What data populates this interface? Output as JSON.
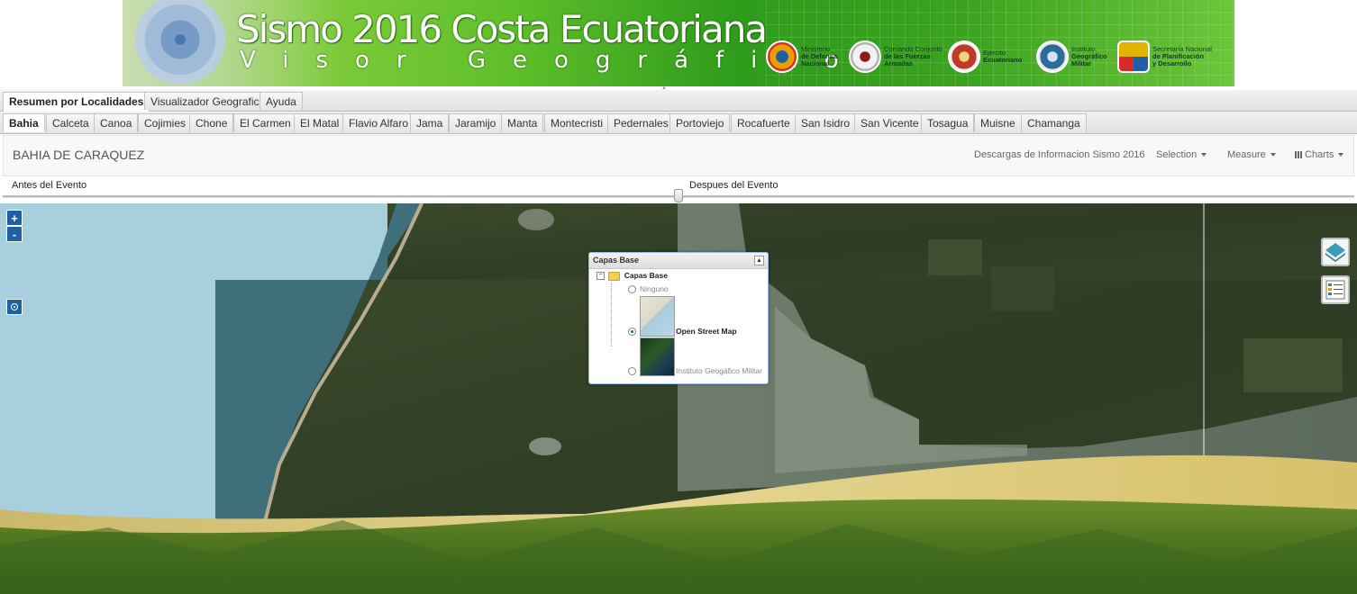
{
  "banner": {
    "title": "Sismo 2016 Costa Ecuatoriana",
    "subtitle": "Visor Geográfico",
    "logos": [
      {
        "line1": "Ministerio",
        "line2": "de Defensa",
        "line3": "Nacional",
        "color": "#e8a000"
      },
      {
        "line1": "Comando Conjunto",
        "line2": "de las Fuerzas",
        "line3": "Armadas",
        "color": "#c8c8c8"
      },
      {
        "line1": "Ejército",
        "line2": "Ecuatoriano",
        "line3": "",
        "color": "#c0392b"
      },
      {
        "line1": "Instituto",
        "line2": "Geográfico",
        "line3": "Militar",
        "color": "#2e6b9a"
      },
      {
        "line1": "Secretaría Nacional",
        "line2": "de Planificación",
        "line3": "y Desarrollo",
        "color": "#e0b400"
      }
    ]
  },
  "main_tabs": [
    {
      "label": "Resumen por Localidades",
      "active": true
    },
    {
      "label": "Visualizador Geografico",
      "active": false
    },
    {
      "label": "Ayuda",
      "active": false
    }
  ],
  "locality_tabs": [
    {
      "label": "Bahia",
      "active": true
    },
    {
      "label": "Calceta"
    },
    {
      "label": "Canoa"
    },
    {
      "label": "Cojimies"
    },
    {
      "label": "Chone"
    },
    {
      "label": "El Carmen"
    },
    {
      "label": "El Matal"
    },
    {
      "label": "Flavio Alfaro"
    },
    {
      "label": "Jama"
    },
    {
      "label": "Jaramijo"
    },
    {
      "label": "Manta"
    },
    {
      "label": "Montecristi"
    },
    {
      "label": "Pedernales"
    },
    {
      "label": "Portoviejo"
    },
    {
      "label": "Rocafuerte"
    },
    {
      "label": "San Isidro"
    },
    {
      "label": "San Vicente"
    },
    {
      "label": "Tosagua"
    },
    {
      "label": "Muisne"
    },
    {
      "label": "Chamanga"
    }
  ],
  "navbar": {
    "brand": "BAHIA DE CARAQUEZ",
    "downloads": "Descargas de Informacion Sismo 2016",
    "selection": "Selection",
    "measure": "Measure",
    "charts": "Charts"
  },
  "swipe": {
    "before_label": "Antes del Evento",
    "after_label": "Despues del Evento",
    "position": 0.5
  },
  "map_controls": {
    "zoom_in": "+",
    "zoom_out": "-"
  },
  "layers_panel": {
    "header": "Capas Base",
    "folder": "Capas Base",
    "options": [
      {
        "label": "Ninguno",
        "selected": false
      },
      {
        "label": "Open Street Map",
        "selected": true
      },
      {
        "label": "Instituto Geogáfico Militar",
        "selected": false
      }
    ]
  },
  "colors": {
    "banner_green": "#3aa21e",
    "control_blue": "#1f5fa5",
    "sea": "#a7cfdd"
  }
}
